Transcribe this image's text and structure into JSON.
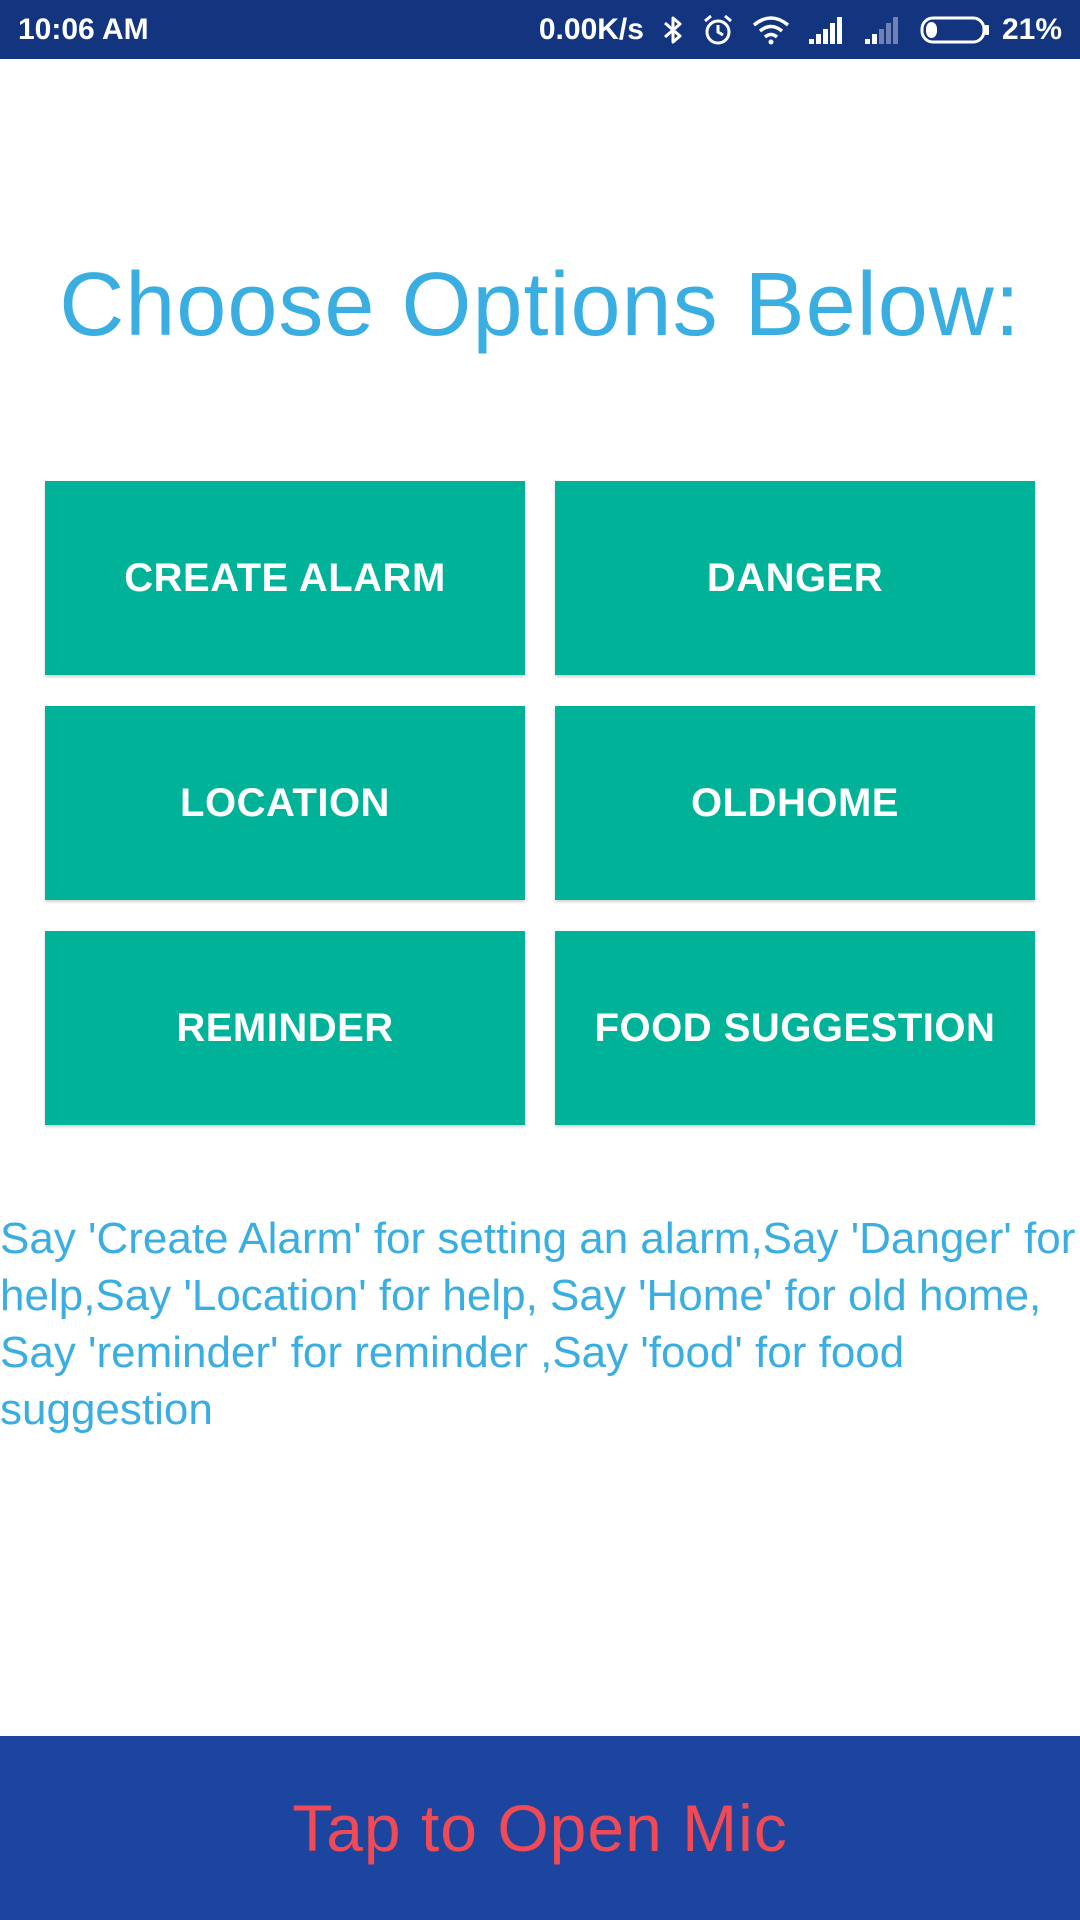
{
  "status_bar": {
    "time": "10:06 AM",
    "network_speed": "0.00K/s",
    "battery_percent": "21%",
    "battery_level": 0.21,
    "icons": [
      "bluetooth-icon",
      "alarm-clock-icon",
      "wifi-icon",
      "signal-icon",
      "signal-weak-icon",
      "battery-icon"
    ]
  },
  "title": "Choose Options Below:",
  "options": [
    {
      "label": "CREATE ALARM"
    },
    {
      "label": "DANGER"
    },
    {
      "label": "LOCATION"
    },
    {
      "label": "OLDHOME"
    },
    {
      "label": "REMINDER"
    },
    {
      "label": "FOOD SUGGESTION"
    }
  ],
  "instructions": "Say 'Create Alarm' for setting an alarm,Say 'Danger' for help,Say 'Location' for help, Say 'Home' for old home, Say 'reminder' for reminder ,Say 'food' for food suggestion",
  "mic_button": {
    "label": "Tap to Open Mic"
  },
  "colors": {
    "status_bar": "#13357f",
    "title_text": "#3aaee0",
    "button_bg": "#00b398",
    "button_text": "#ffffff",
    "mic_bar_bg": "#1c45a0",
    "mic_text": "#ef4a55"
  }
}
